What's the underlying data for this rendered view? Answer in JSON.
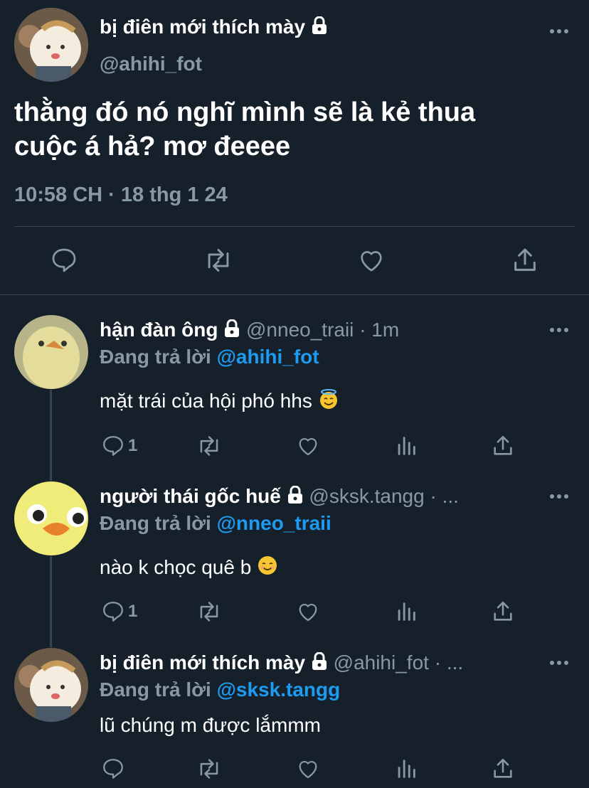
{
  "main_tweet": {
    "display_name": "bị điên mới thích mày",
    "handle": "@ahihi_fot",
    "text_line1": "thằng đó nó nghĩ mình sẽ là kẻ thua",
    "text_line2": "cuộc á hả? mơ đeeee",
    "timestamp": "10:58 CH · 18 thg 1 24"
  },
  "replies": [
    {
      "display_name": "hận đàn ông",
      "handle": "@nneo_traii",
      "time": "· 1m",
      "replying_prefix": "Đang trả lời",
      "replying_to": "@ahihi_fot",
      "text": "mặt trái của hội phó hhs",
      "reply_count": "1"
    },
    {
      "display_name": "người thái gốc huế",
      "handle": "@sksk.tangg",
      "time": "· ...",
      "replying_prefix": "Đang trả lời",
      "replying_to": "@nneo_traii",
      "text": "nào k chọc quê b",
      "reply_count": "1"
    },
    {
      "display_name": "bị điên mới thích mày",
      "handle": "@ahihi_fot",
      "time": "· ...",
      "replying_prefix": "Đang trả lời",
      "replying_to": "@sksk.tangg",
      "text": "lũ chúng m được lắmmm",
      "reply_count": ""
    }
  ],
  "colors": {
    "background": "#15202b",
    "muted_text": "#8899a6",
    "link": "#1d9bf0",
    "divider": "#38444d"
  },
  "icons": [
    "lock-icon",
    "more-icon",
    "reply-icon",
    "retweet-icon",
    "like-icon",
    "share-icon",
    "analytics-icon",
    "halo-emoji",
    "smile-emoji"
  ]
}
